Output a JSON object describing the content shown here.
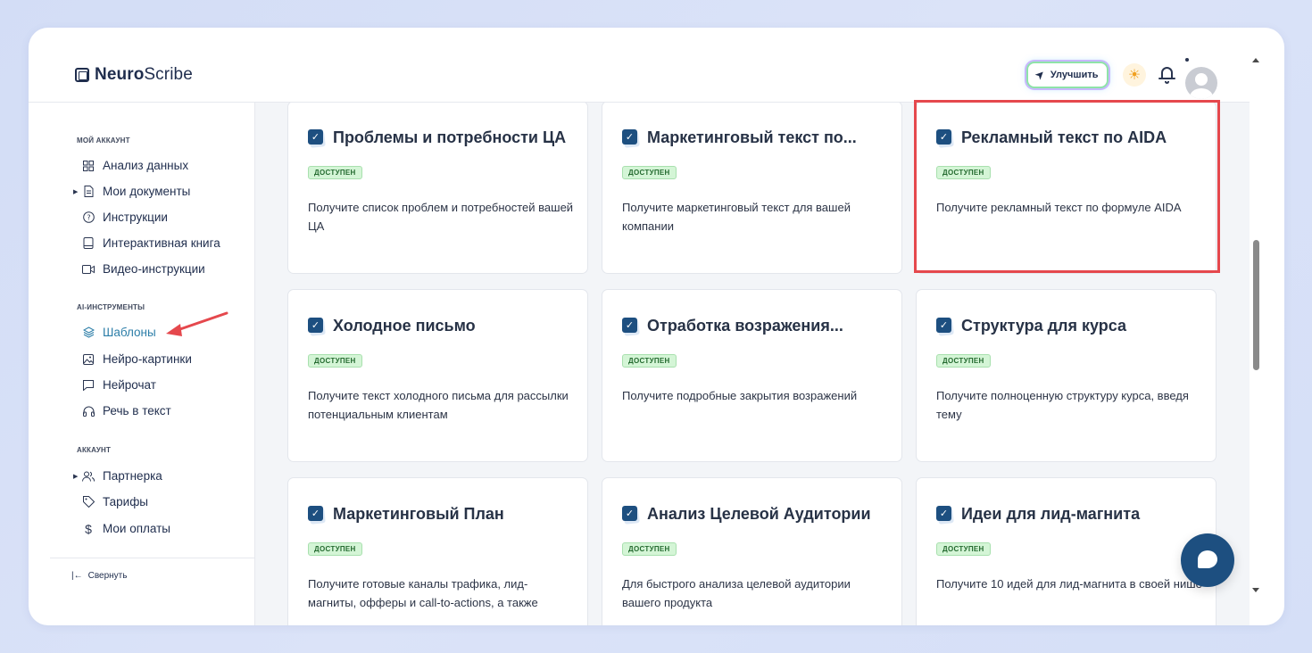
{
  "header": {
    "logo_bold": "Neuro",
    "logo_rest": "Scribe",
    "upgrade_label": "Улучшить"
  },
  "sidebar": {
    "section_account": "МОЙ АККАУНТ",
    "section_ai": "AI-ИНСТРУМЕНТЫ",
    "section_acc2": "АККАУНТ",
    "items": [
      {
        "label": "Анализ данных",
        "icon": "grid-icon"
      },
      {
        "label": "Мои документы",
        "icon": "document-icon"
      },
      {
        "label": "Инструкции",
        "icon": "help-circle-icon"
      },
      {
        "label": "Интерактивная книга",
        "icon": "book-icon"
      },
      {
        "label": "Видео-инструкции",
        "icon": "video-icon"
      },
      {
        "label": "Шаблоны",
        "icon": "layers-icon"
      },
      {
        "label": "Нейро-картинки",
        "icon": "image-icon"
      },
      {
        "label": "Нейрочат",
        "icon": "chat-icon"
      },
      {
        "label": "Речь в текст",
        "icon": "headphones-icon"
      },
      {
        "label": "Партнерка",
        "icon": "users-icon"
      },
      {
        "label": "Тарифы",
        "icon": "tag-icon"
      },
      {
        "label": "Мои оплаты",
        "icon": "dollar-icon"
      }
    ],
    "collapse_label": "Свернуть"
  },
  "badge_label": "ДОСТУПЕН",
  "cards": [
    {
      "title": "Проблемы и потребности ЦА",
      "desc": "Получите список проблем и потребностей вашей ЦА"
    },
    {
      "title": "Маркетинговый текст по...",
      "desc": "Получите маркетинговый текст для вашей компании"
    },
    {
      "title": "Рекламный текст по AIDA",
      "desc": "Получите рекламный текст по формуле AIDA"
    },
    {
      "title": "Холодное письмо",
      "desc": "Получите текст холодного письма для рассылки потенциальным клиентам"
    },
    {
      "title": "Отработка возражения...",
      "desc": "Получите подробные закрытия возражений"
    },
    {
      "title": "Структура для курса",
      "desc": "Получите полноценную структуру курса, введя тему"
    },
    {
      "title": "Маркетинговый План",
      "desc": "Получите готовые каналы трафика, лид-магниты, офферы и call-to-actions, а также"
    },
    {
      "title": "Анализ Целевой Аудитории",
      "desc": "Для быстрого анализа целевой аудитории вашего продукта"
    },
    {
      "title": "Идеи для лид-магнита",
      "desc": "Получите 10 идей для лид-магнита в своей нише"
    }
  ],
  "colors": {
    "accent": "#1d4f80",
    "active_nav": "#2c7ea8",
    "badge_bg": "#d4f5d6",
    "highlight": "#e5484d"
  }
}
